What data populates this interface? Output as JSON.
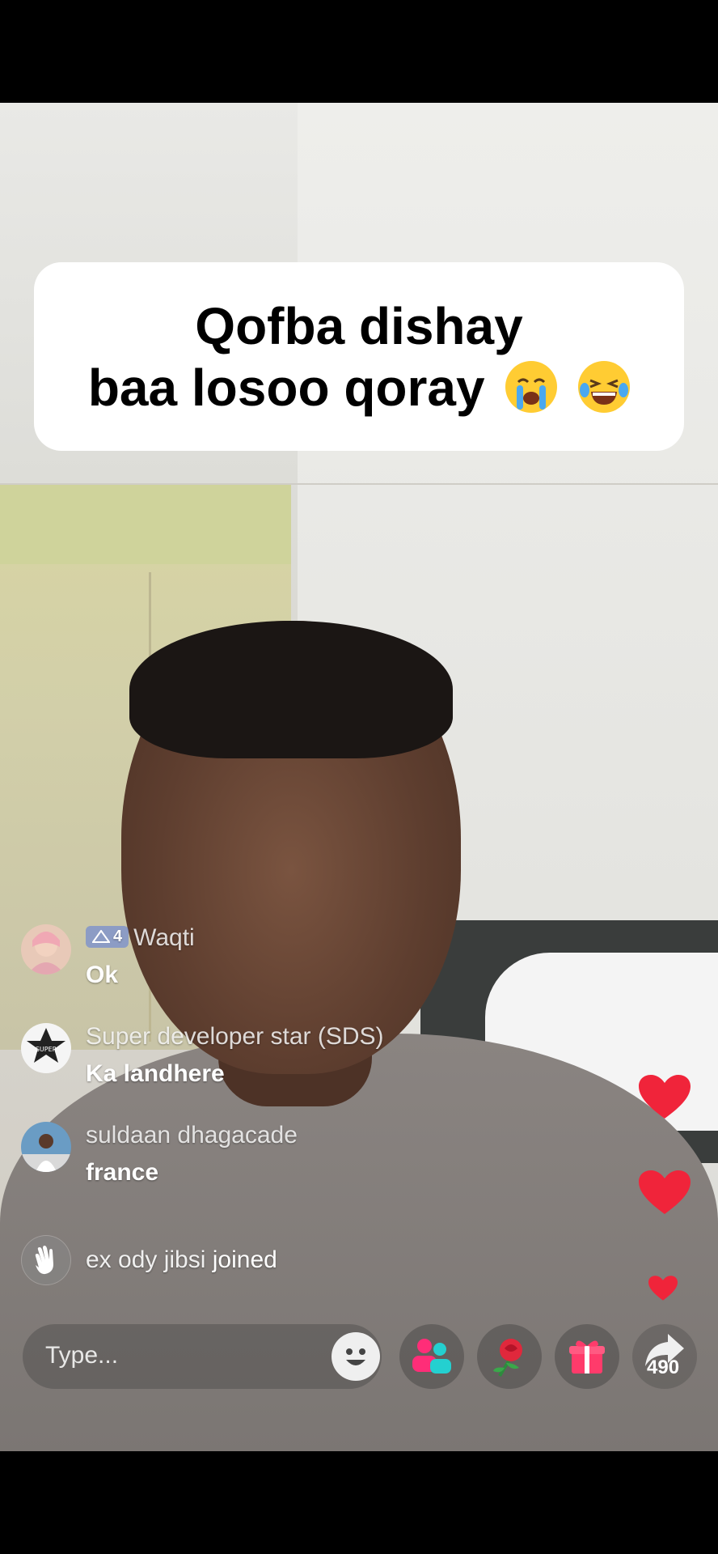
{
  "caption": {
    "line1": "Qofba dishay",
    "line2": "baa losoo qoray"
  },
  "chat": [
    {
      "badge": "4",
      "name": "Waqti",
      "message": "Ok"
    },
    {
      "name": "Super developer star (SDS)",
      "message": "Ka landhere"
    },
    {
      "name": "suldaan dhagacade",
      "message": "france"
    },
    {
      "name": "ex ody jibsi",
      "joined": "joined"
    }
  ],
  "bottom_bar": {
    "placeholder": "Type...",
    "share_count": "490"
  },
  "icons": [
    "emoji-icon",
    "friends-icon",
    "rose-icon",
    "gift-icon",
    "share-icon",
    "heart-icon",
    "wave-icon"
  ],
  "colors": {
    "heart": "#f0243a",
    "friends_pink": "#ff2d78",
    "friends_teal": "#24d0d0",
    "gift": "#ff3b6b"
  }
}
